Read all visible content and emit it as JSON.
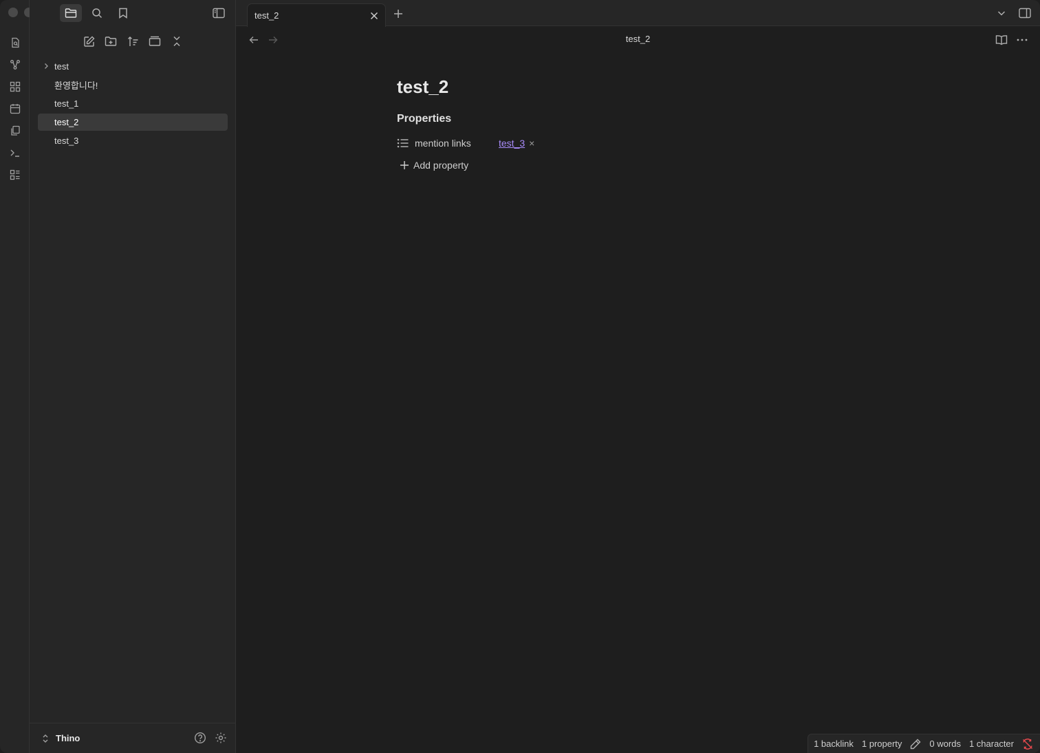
{
  "sidebar": {
    "tree": [
      {
        "label": "test",
        "type": "folder"
      },
      {
        "label": "환영합니다!",
        "type": "file"
      },
      {
        "label": "test_1",
        "type": "file"
      },
      {
        "label": "test_2",
        "type": "file",
        "active": true
      },
      {
        "label": "test_3",
        "type": "file"
      }
    ],
    "vault_name": "Thino"
  },
  "tabs": [
    {
      "label": "test_2",
      "active": true
    }
  ],
  "view": {
    "title": "test_2"
  },
  "note": {
    "title": "test_2",
    "properties_heading": "Properties",
    "properties": [
      {
        "key": "mention links",
        "value": "test_3",
        "remove": "×"
      }
    ],
    "add_property_label": "Add property"
  },
  "statusbar": {
    "backlinks": "1 backlink",
    "properties": "1 property",
    "words": "0 words",
    "characters": "1 character"
  },
  "colors": {
    "background": "#1e1e1e",
    "sidebar": "#262626",
    "accent_link": "#a88bfa",
    "sync_error": "#e5484d"
  }
}
